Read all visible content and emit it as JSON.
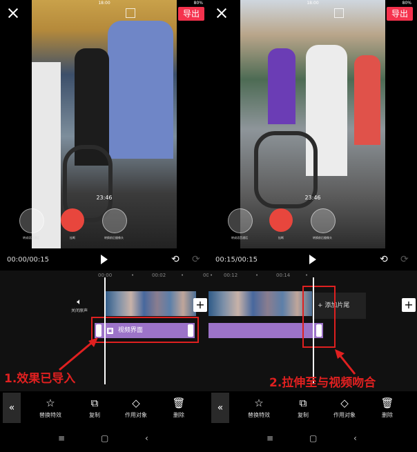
{
  "left": {
    "export_label": "导出",
    "call_time": "23:46",
    "call_btn_labels": [
      "转成语音通话",
      "挂断",
      "转换前后摄像头"
    ],
    "timecode": "00:00/00:15",
    "ruler_ticks": [
      "00:00",
      "•",
      "00:02",
      "•",
      "00"
    ],
    "mute_label": "关闭原声",
    "effect_label": "视频界面",
    "annotation": "1.效果已导入",
    "tools": [
      "替换特效",
      "复制",
      "作用对象",
      "删除"
    ]
  },
  "right": {
    "export_label": "导出",
    "call_time": "23:46",
    "call_btn_labels": [
      "转成语音通话",
      "挂断",
      "转换前后摄像头"
    ],
    "timecode": "00:15/00:15",
    "ruler_ticks": [
      "•",
      "00:12",
      "•",
      "00:14",
      "•"
    ],
    "add_tail_label": "添加片尾",
    "annotation": "2.拉伸至与视频吻合",
    "tools": [
      "替换特效",
      "复制",
      "作用对象",
      "删除"
    ]
  },
  "icons": {
    "close": "close-icon",
    "play": "play-icon",
    "undo": "undo-icon",
    "redo": "redo-icon",
    "speaker": "speaker-icon",
    "back": "double-chevron-left-icon",
    "replace": "star-swap-icon",
    "copy": "copy-icon",
    "target": "layers-icon",
    "delete": "trash-icon",
    "nav_menu": "menu-icon",
    "nav_home": "home-icon",
    "nav_back": "back-icon"
  },
  "colors": {
    "accent": "#f5324d",
    "effect_clip": "#9c73c8",
    "annotation": "#e02020"
  }
}
